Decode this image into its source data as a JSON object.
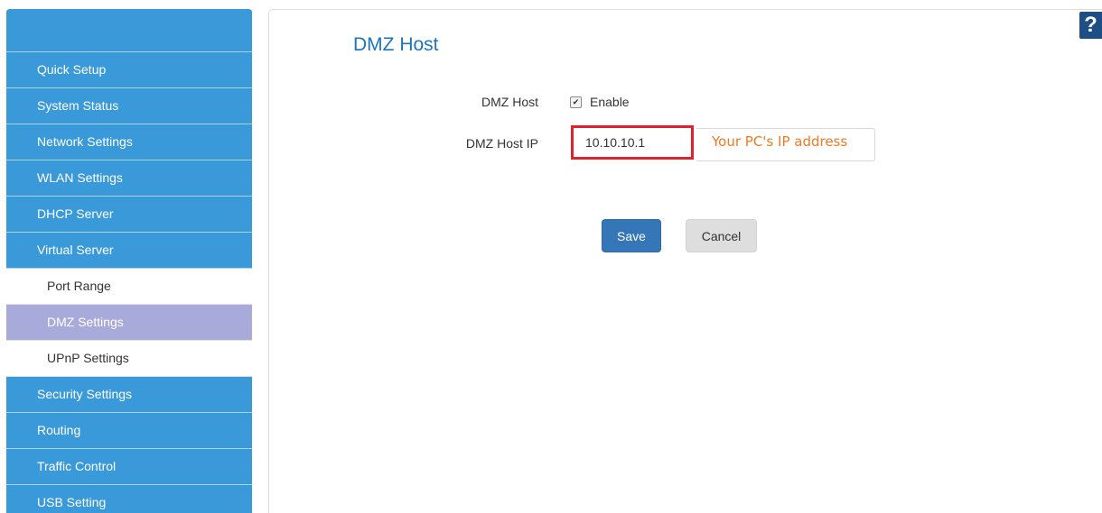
{
  "sidebar": {
    "items": [
      {
        "label": "Quick Setup"
      },
      {
        "label": "System Status"
      },
      {
        "label": "Network Settings"
      },
      {
        "label": "WLAN Settings"
      },
      {
        "label": "DHCP Server"
      },
      {
        "label": "Virtual Server"
      }
    ],
    "subitems": [
      {
        "label": "Port Range"
      },
      {
        "label": "DMZ Settings",
        "active": true
      },
      {
        "label": "UPnP Settings"
      }
    ],
    "items_after": [
      {
        "label": "Security Settings"
      },
      {
        "label": "Routing"
      },
      {
        "label": "Traffic Control"
      },
      {
        "label": "USB Setting"
      }
    ]
  },
  "main": {
    "title": "DMZ Host",
    "help_icon": "?",
    "form": {
      "dmz_host_label": "DMZ Host",
      "enable_label": "Enable",
      "enable_checked": true,
      "dmz_host_ip_label": "DMZ Host IP",
      "dmz_host_ip_value": "10.10.10.1",
      "hint": "Your PC's IP address"
    },
    "buttons": {
      "save": "Save",
      "cancel": "Cancel"
    }
  },
  "colors": {
    "sidebar_bg": "#3a9ad9",
    "active_sub_bg": "#a8aad9",
    "title_blue": "#1e73be",
    "highlight_red": "#e0222c",
    "hint_orange": "#f07a22",
    "save_blue": "#3476b7"
  },
  "icons": {
    "help": "question-mark-icon",
    "checkbox": "checkmark-icon"
  }
}
